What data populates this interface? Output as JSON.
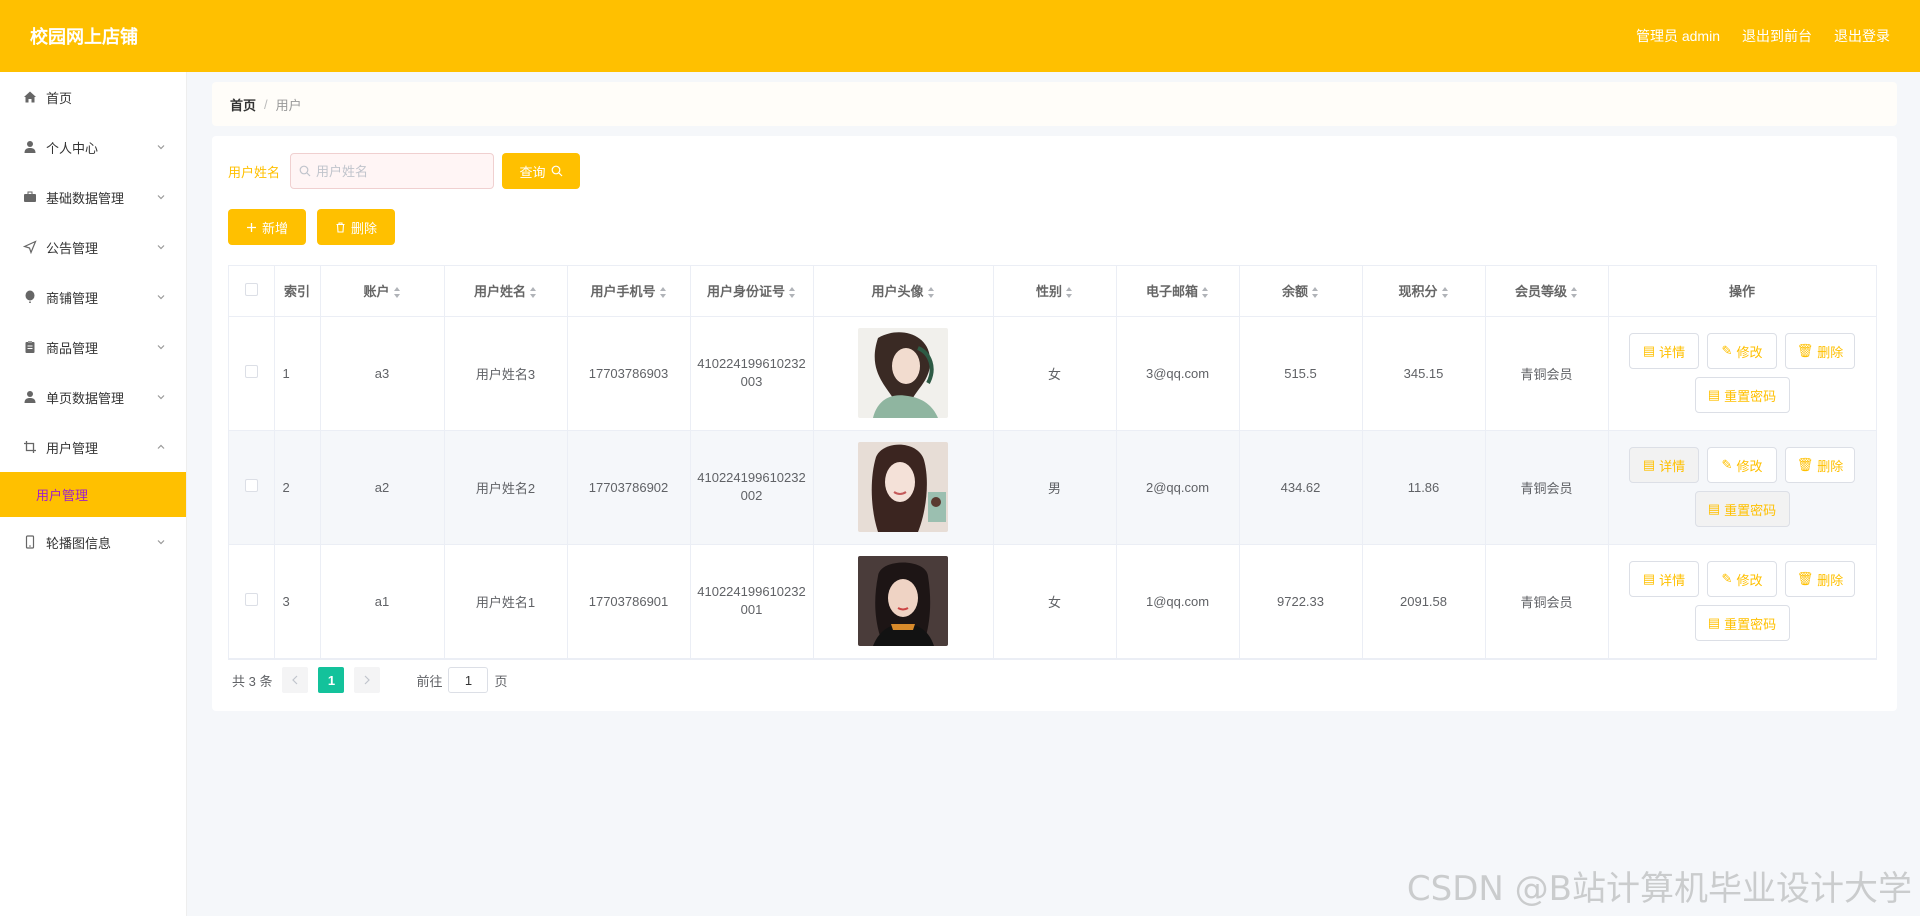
{
  "header": {
    "brand": "校园网上店铺",
    "admin_label": "管理员 admin",
    "to_front": "退出到前台",
    "logout": "退出登录"
  },
  "sidebar": {
    "items": [
      {
        "label": "首页",
        "icon": "home-icon"
      },
      {
        "label": "个人中心",
        "icon": "user-icon"
      },
      {
        "label": "基础数据管理",
        "icon": "briefcase-icon"
      },
      {
        "label": "公告管理",
        "icon": "send-icon"
      },
      {
        "label": "商铺管理",
        "icon": "balloon-icon"
      },
      {
        "label": "商品管理",
        "icon": "clipboard-icon"
      },
      {
        "label": "单页数据管理",
        "icon": "user-icon"
      },
      {
        "label": "用户管理",
        "icon": "crop-icon"
      },
      {
        "label": "轮播图信息",
        "icon": "mobile-icon"
      }
    ],
    "active_sub": "用户管理"
  },
  "breadcrumb": {
    "home": "首页",
    "sep": "/",
    "current": "用户"
  },
  "search": {
    "label": "用户姓名",
    "placeholder": "用户姓名",
    "query_button": "查询"
  },
  "actions": {
    "add": "新增",
    "delete": "删除"
  },
  "table": {
    "headers": [
      "索引",
      "账户",
      "用户姓名",
      "用户手机号",
      "用户身份证号",
      "用户头像",
      "性别",
      "电子邮箱",
      "余额",
      "现积分",
      "会员等级",
      "操作"
    ],
    "rows": [
      {
        "index": "1",
        "account": "a3",
        "name": "用户姓名3",
        "phone": "17703786903",
        "idcard": "410224199610232003",
        "gender": "女",
        "email": "3@qq.com",
        "balance": "515.5",
        "points": "345.15",
        "level": "青铜会员"
      },
      {
        "index": "2",
        "account": "a2",
        "name": "用户姓名2",
        "phone": "17703786902",
        "idcard": "410224199610232002",
        "gender": "男",
        "email": "2@qq.com",
        "balance": "434.62",
        "points": "11.86",
        "level": "青铜会员"
      },
      {
        "index": "3",
        "account": "a1",
        "name": "用户姓名1",
        "phone": "17703786901",
        "idcard": "410224199610232001",
        "gender": "女",
        "email": "1@qq.com",
        "balance": "9722.33",
        "points": "2091.58",
        "level": "青铜会员"
      }
    ],
    "op_labels": {
      "detail": "详情",
      "edit": "修改",
      "delete": "删除",
      "reset": "重置密码"
    }
  },
  "pager": {
    "total": "共 3 条",
    "current_page": "1",
    "goto_prefix": "前往",
    "goto_value": "1",
    "goto_suffix": "页"
  },
  "watermark": "CSDN @B站计算机毕业设计大学",
  "colors": {
    "accent": "#ffc000",
    "page_active": "#13c29b",
    "submenu_text": "#a020c8"
  }
}
